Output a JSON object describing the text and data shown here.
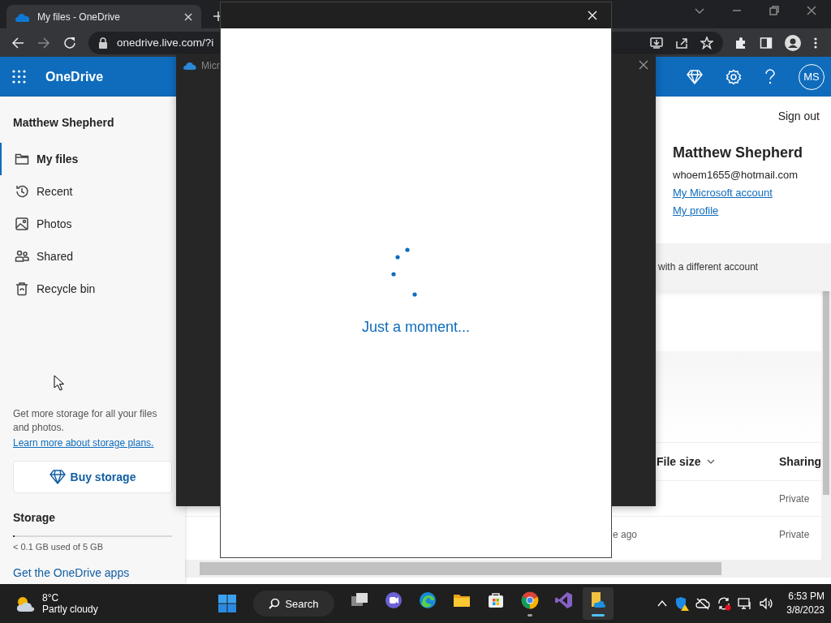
{
  "browser": {
    "tabs": [
      {
        "title": "My files - OneDrive",
        "selected": true
      }
    ],
    "address": "onedrive.live.com/?i"
  },
  "app": {
    "name": "OneDrive",
    "avatar": "MS"
  },
  "sidebar": {
    "user": "Matthew Shepherd",
    "items": [
      {
        "label": "My files",
        "kind": "folder",
        "selected": true
      },
      {
        "label": "Recent",
        "kind": "recent",
        "selected": false
      },
      {
        "label": "Photos",
        "kind": "photo",
        "selected": false
      },
      {
        "label": "Shared",
        "kind": "people",
        "selected": false
      },
      {
        "label": "Recycle bin",
        "kind": "bin",
        "selected": false
      }
    ],
    "promo": "Get more storage for all your files and photos.",
    "promo_link": "Learn more about storage plans.",
    "buy_button": "Buy storage",
    "storage_title": "Storage",
    "storage": {
      "level": 0.01,
      "reading": "< 0.1 GB used of 5 GB"
    },
    "apps_link": "Get the OneDrive apps"
  },
  "file_list": {
    "columns": [
      "File size",
      "Sharing"
    ],
    "rows": [
      {
        "column_1": "",
        "sharing": "Private"
      },
      {
        "column_1": "e ago",
        "sharing": "Private"
      }
    ]
  },
  "account_panel": {
    "sign_out": "Sign out",
    "name": "Matthew Shepherd",
    "email": "whoem1655@hotmail.com",
    "links": [
      "My Microsoft account",
      "My profile"
    ],
    "switch_account": "with a different account"
  },
  "signin_window": {
    "title": "Micr"
  },
  "dialog": {
    "message": "Just a moment..."
  },
  "taskbar": {
    "weather": {
      "temperature": "8°C",
      "condition": "Partly cloudy"
    },
    "search": "Search",
    "apps": [
      {
        "kind": "task-view",
        "running": false,
        "selected": false
      },
      {
        "kind": "chat",
        "running": false,
        "selected": false
      },
      {
        "kind": "edge",
        "running": false,
        "selected": false
      },
      {
        "kind": "explorer",
        "running": false,
        "selected": false
      },
      {
        "kind": "store",
        "running": false,
        "selected": false
      },
      {
        "kind": "chrome",
        "running": true,
        "selected": false
      },
      {
        "kind": "visual-studio",
        "running": false,
        "selected": false
      },
      {
        "kind": "file-app",
        "running": true,
        "selected": true
      }
    ],
    "time": "6:53 PM",
    "date": "3/8/2023"
  }
}
